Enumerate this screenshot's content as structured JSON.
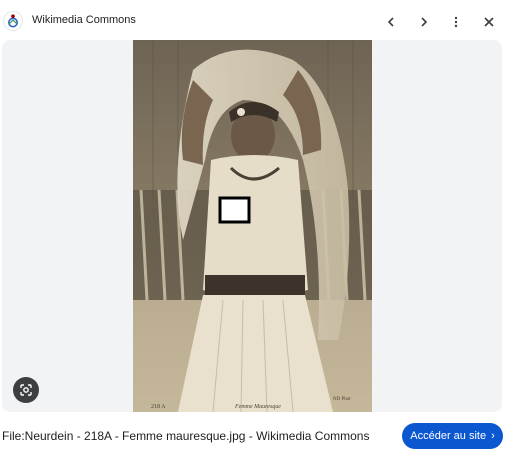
{
  "header": {
    "site_name": "Wikimedia Commons",
    "site_icon": "wikimedia-logo-icon",
    "buttons": [
      "chevron-left-icon",
      "chevron-right-icon",
      "more-vert-icon",
      "close-icon"
    ]
  },
  "image": {
    "photo_inscription_left": "218 A",
    "photo_inscription_center": "Femme Mauresque",
    "photo_inscription_right": "ND Phot"
  },
  "lens": {
    "icon": "lens-search-icon"
  },
  "caption": "File:Neurdein - 218A - Femme mauresque.jpg - Wikimedia Commons",
  "visit": {
    "label": "Accéder au site",
    "chevron": "›"
  },
  "colors": {
    "accent": "#0b57d0",
    "viewer_bg": "#f1f3f4",
    "photo_sepia": "#9c8f78"
  }
}
